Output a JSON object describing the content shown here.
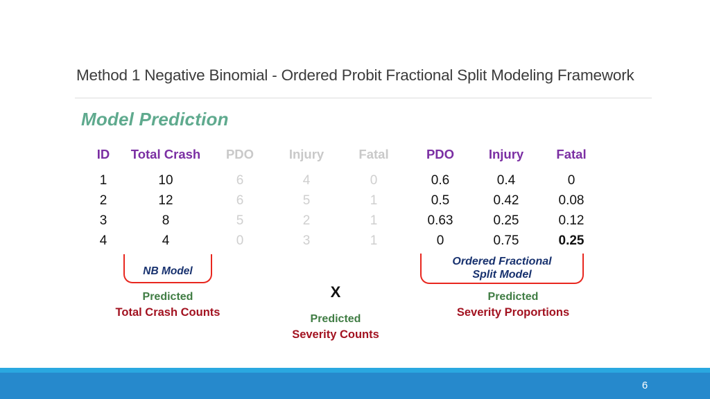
{
  "slide": {
    "title": "Method 1 Negative Binomial - Ordered Probit Fractional Split Modeling Framework",
    "section_heading": "Model Prediction",
    "page_number": "6"
  },
  "colors": {
    "heading_teal": "#5faa8e",
    "header_purple": "#7b2fa3",
    "muted_grey": "#c9c9c9",
    "bracket_red": "#e8271f",
    "label_blue": "#17316e",
    "caption_green": "#3f7c43",
    "caption_red": "#a21220",
    "footer_blue": "#2689cc",
    "footer_strip_blue": "#2aa8e0"
  },
  "chart_data": {
    "type": "table",
    "title": "Model Prediction",
    "columns": [
      {
        "label": "ID",
        "style": "active"
      },
      {
        "label": "Total Crash",
        "style": "active"
      },
      {
        "label": "PDO",
        "style": "muted"
      },
      {
        "label": "Injury",
        "style": "muted"
      },
      {
        "label": "Fatal",
        "style": "muted"
      },
      {
        "label": "PDO",
        "style": "active"
      },
      {
        "label": "Injury",
        "style": "active"
      },
      {
        "label": "Fatal",
        "style": "active"
      }
    ],
    "rows": [
      [
        "1",
        "10",
        "6",
        "4",
        "0",
        "0.6",
        "0.4",
        "0"
      ],
      [
        "2",
        "12",
        "6",
        "5",
        "1",
        "0.5",
        "0.42",
        "0.08"
      ],
      [
        "3",
        "8",
        "5",
        "2",
        "1",
        "0.63",
        "0.25",
        "0.12"
      ],
      [
        "4",
        "4",
        "0",
        "3",
        "1",
        "0",
        "0.75",
        "0.25"
      ]
    ],
    "bold_cells": [
      [
        3,
        7
      ]
    ],
    "notes": "Columns 3-5 (severity counts) are greyed out; columns 6-8 are predicted severity proportions."
  },
  "table": {
    "headers": [
      "ID",
      "Total Crash",
      "PDO",
      "Injury",
      "Fatal",
      "PDO",
      "Injury",
      "Fatal"
    ],
    "rows": [
      {
        "id": "1",
        "total_crash": "10",
        "pdo_count": "6",
        "injury_count": "4",
        "fatal_count": "0",
        "pdo_prop": "0.6",
        "injury_prop": "0.4",
        "fatal_prop": "0"
      },
      {
        "id": "2",
        "total_crash": "12",
        "pdo_count": "6",
        "injury_count": "5",
        "fatal_count": "1",
        "pdo_prop": "0.5",
        "injury_prop": "0.42",
        "fatal_prop": "0.08"
      },
      {
        "id": "3",
        "total_crash": "8",
        "pdo_count": "5",
        "injury_count": "2",
        "fatal_count": "1",
        "pdo_prop": "0.63",
        "injury_prop": "0.25",
        "fatal_prop": "0.12"
      },
      {
        "id": "4",
        "total_crash": "4",
        "pdo_count": "0",
        "injury_count": "3",
        "fatal_count": "1",
        "pdo_prop": "0",
        "injury_prop": "0.75",
        "fatal_prop": "0.25"
      }
    ]
  },
  "annotations": {
    "left": {
      "model_label": "NB Model",
      "caption_top": "Predicted",
      "caption_bottom": "Total Crash Counts"
    },
    "center": {
      "operator": "X",
      "caption_top": "Predicted",
      "caption_bottom": "Severity Counts"
    },
    "right": {
      "model_label": "Ordered Fractional\nSplit Model",
      "model_label_line1": "Ordered Fractional",
      "model_label_line2": "Split Model",
      "caption_top": "Predicted",
      "caption_bottom": "Severity Proportions"
    }
  }
}
